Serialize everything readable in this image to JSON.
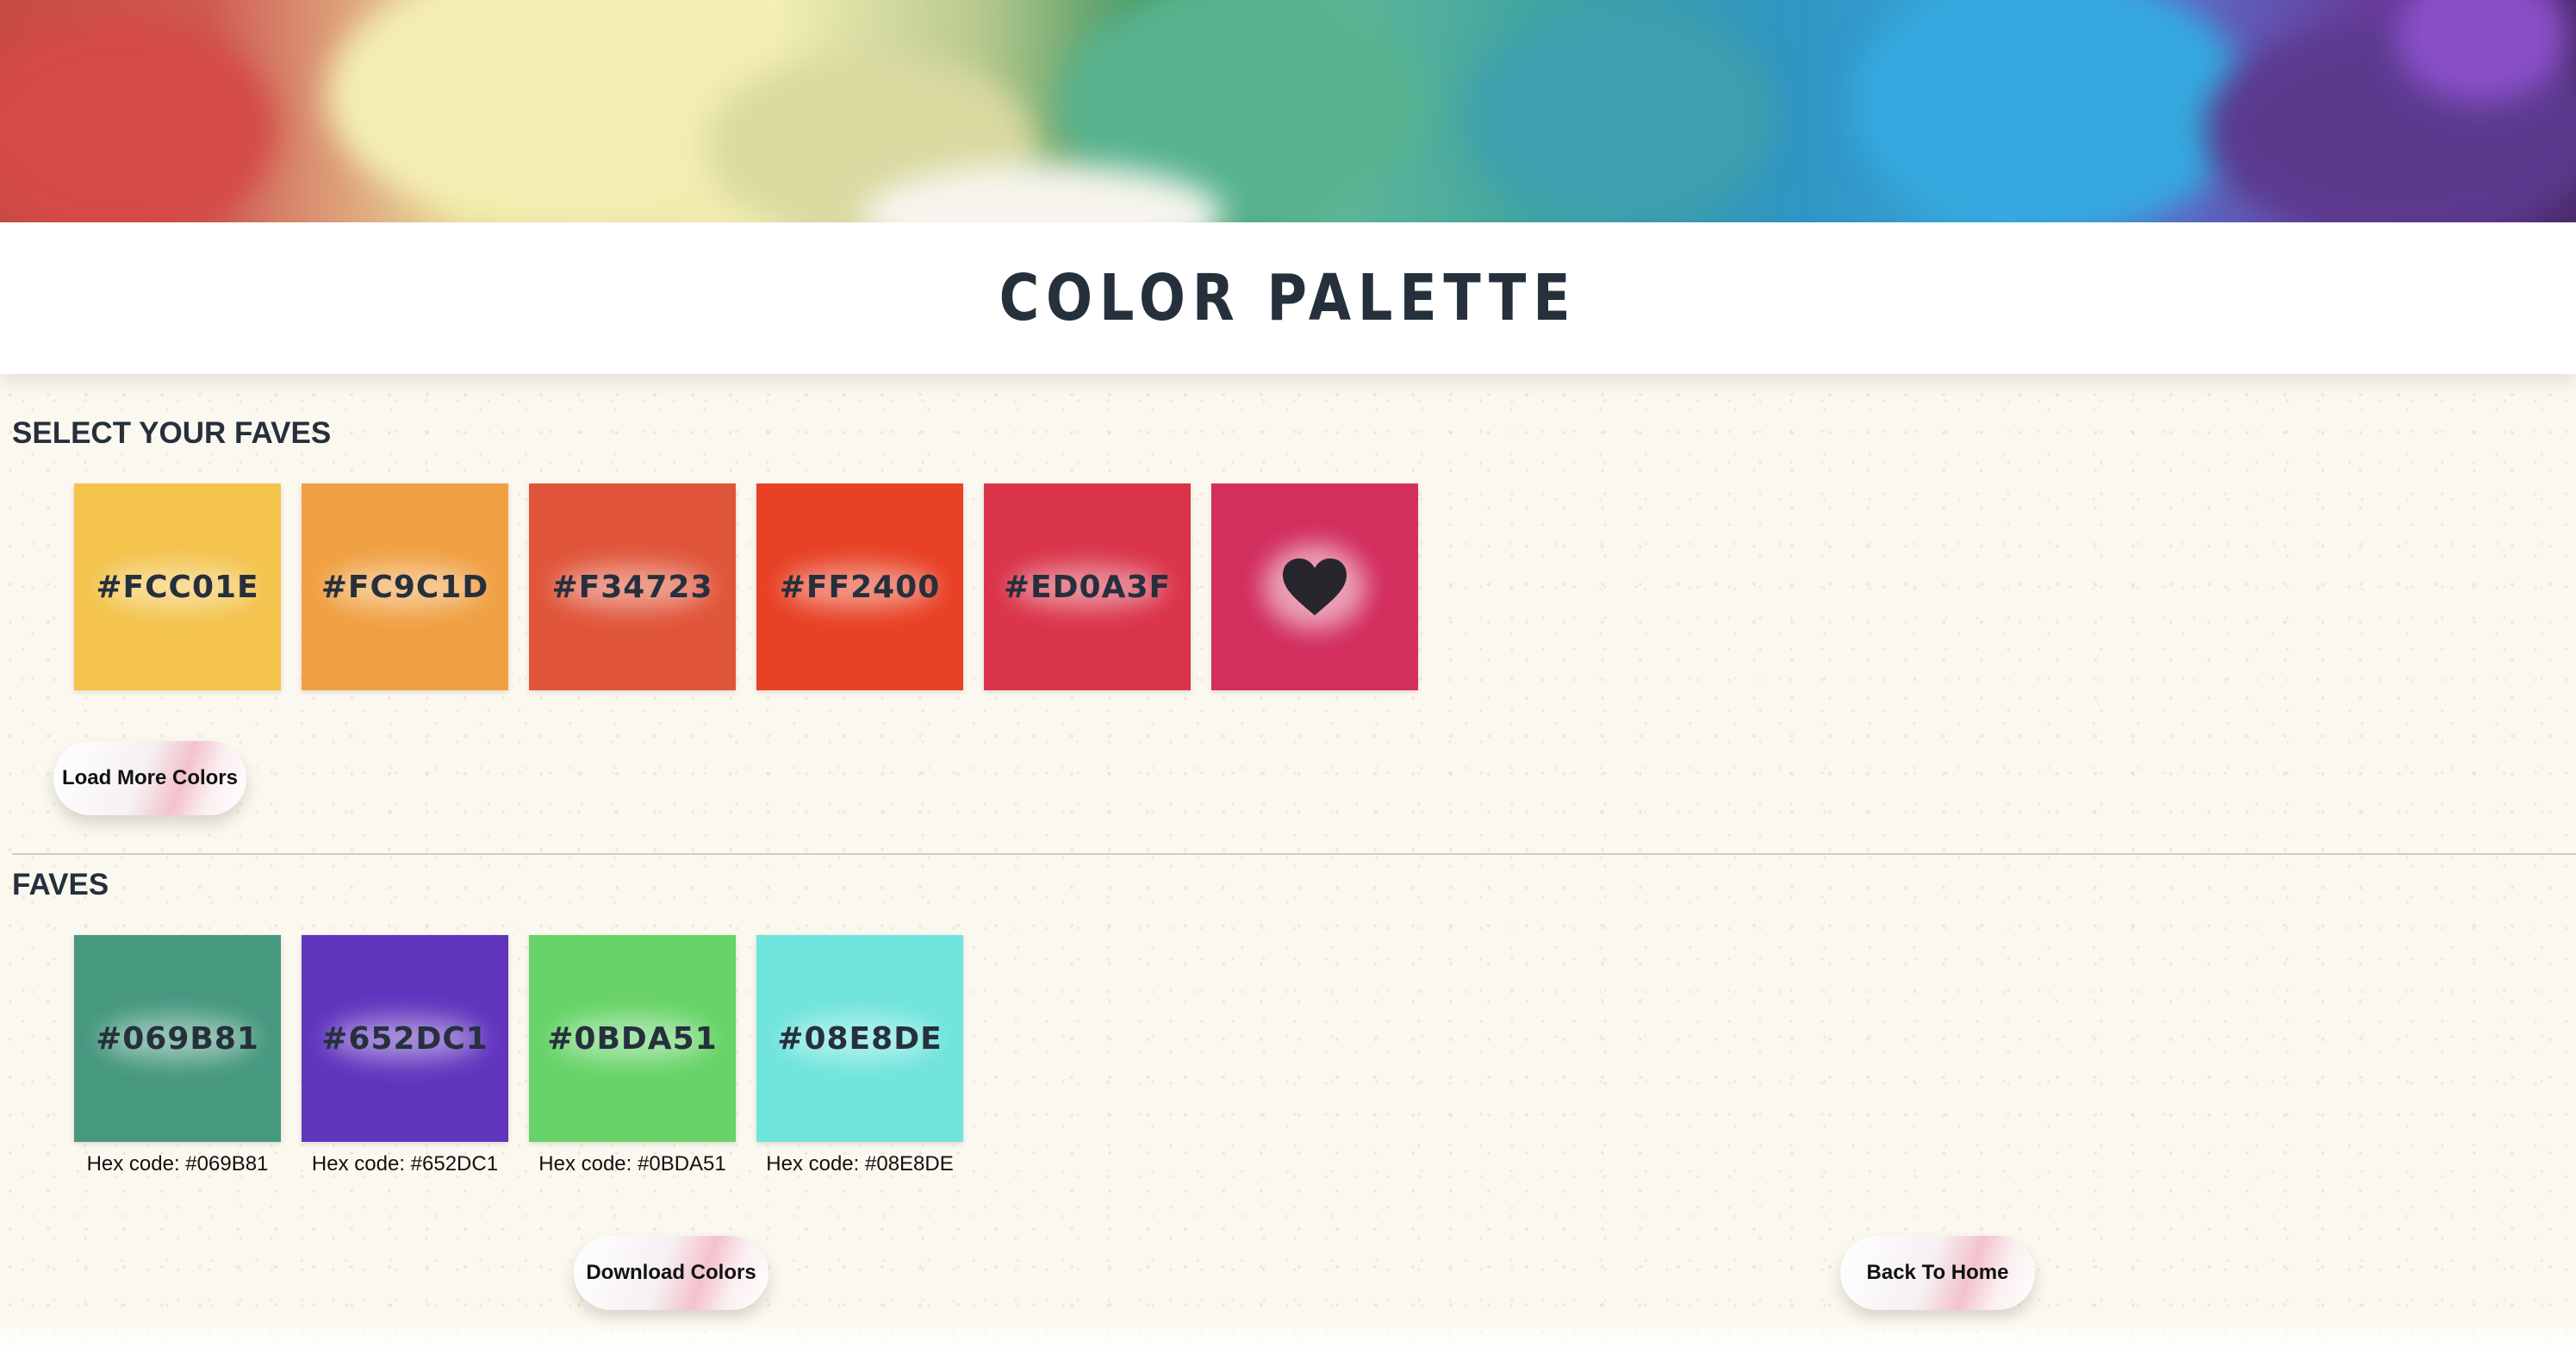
{
  "page": {
    "title": "COLOR PALETTE"
  },
  "select_section": {
    "heading": "SELECT YOUR FAVES",
    "swatches": [
      {
        "hex": "#FCC01E",
        "color": "#F3C34C"
      },
      {
        "hex": "#FC9C1D",
        "color": "#F0A042"
      },
      {
        "hex": "#F34723",
        "color": "#E0553A"
      },
      {
        "hex": "#FF2400",
        "color": "#E84125"
      },
      {
        "hex": "#ED0A3F",
        "color": "#DA344A"
      }
    ],
    "heart_swatch": {
      "icon": "heart-icon",
      "color": "#D22E5E"
    },
    "load_more_label": "Load More Colors"
  },
  "faves_section": {
    "heading": "FAVES",
    "swatches": [
      {
        "hex": "#069B81",
        "color": "#46987F",
        "caption": "Hex code: #069B81"
      },
      {
        "hex": "#652DC1",
        "color": "#6134BE",
        "caption": "Hex code: #652DC1"
      },
      {
        "hex": "#0BDA51",
        "color": "#67D368",
        "caption": "Hex code: #0BDA51"
      },
      {
        "hex": "#08E8DE",
        "color": "#6FE4DC",
        "caption": "Hex code: #08E8DE"
      }
    ]
  },
  "actions": {
    "download_label": "Download Colors",
    "home_label": "Back To Home"
  }
}
